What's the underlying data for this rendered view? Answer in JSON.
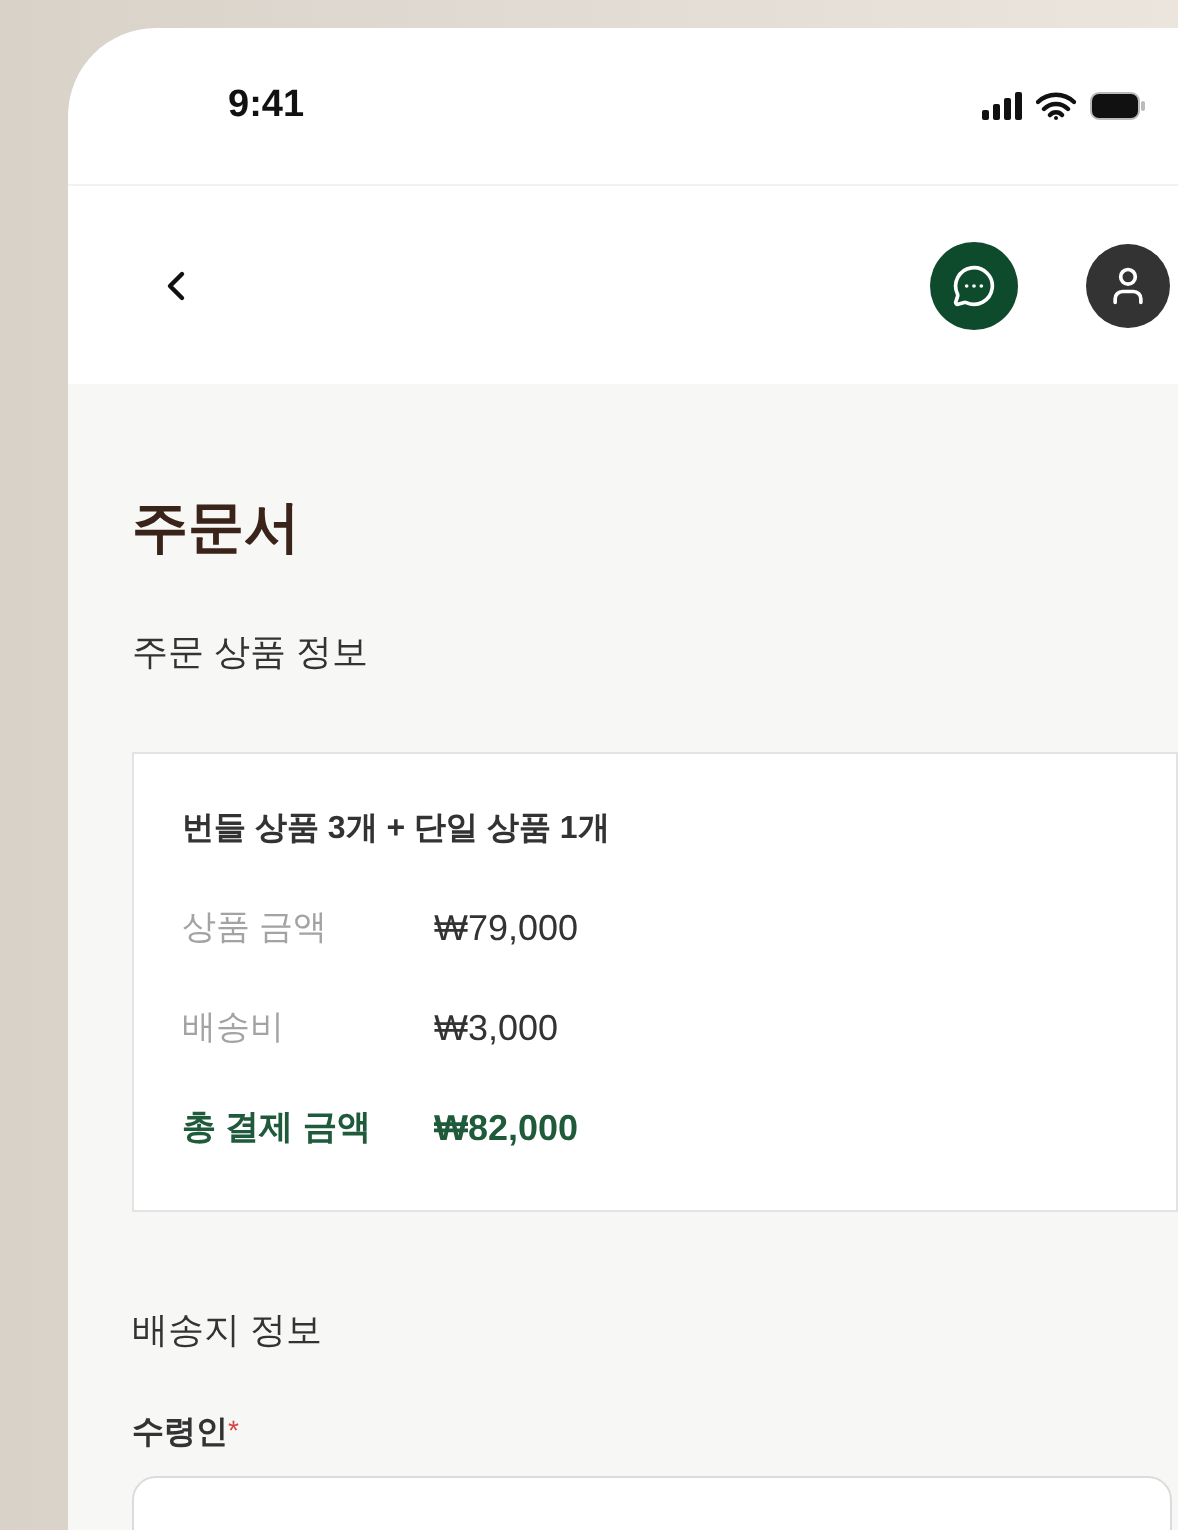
{
  "status_bar": {
    "time": "9:41"
  },
  "page": {
    "title": "주문서"
  },
  "order_section": {
    "heading": "주문 상품 정보",
    "summary": "번들 상품 3개 + 단일 상품 1개",
    "rows": [
      {
        "kind": "normal",
        "label": "상품 금액",
        "value": "₩79,000"
      },
      {
        "kind": "normal",
        "label": "배송비",
        "value": "₩3,000"
      },
      {
        "kind": "total",
        "label": "총 결제 금액",
        "value": "₩82,000"
      }
    ]
  },
  "shipping_section": {
    "heading": "배송지 정보",
    "fields": [
      {
        "label": "수령인",
        "required_mark": "*"
      }
    ]
  }
}
